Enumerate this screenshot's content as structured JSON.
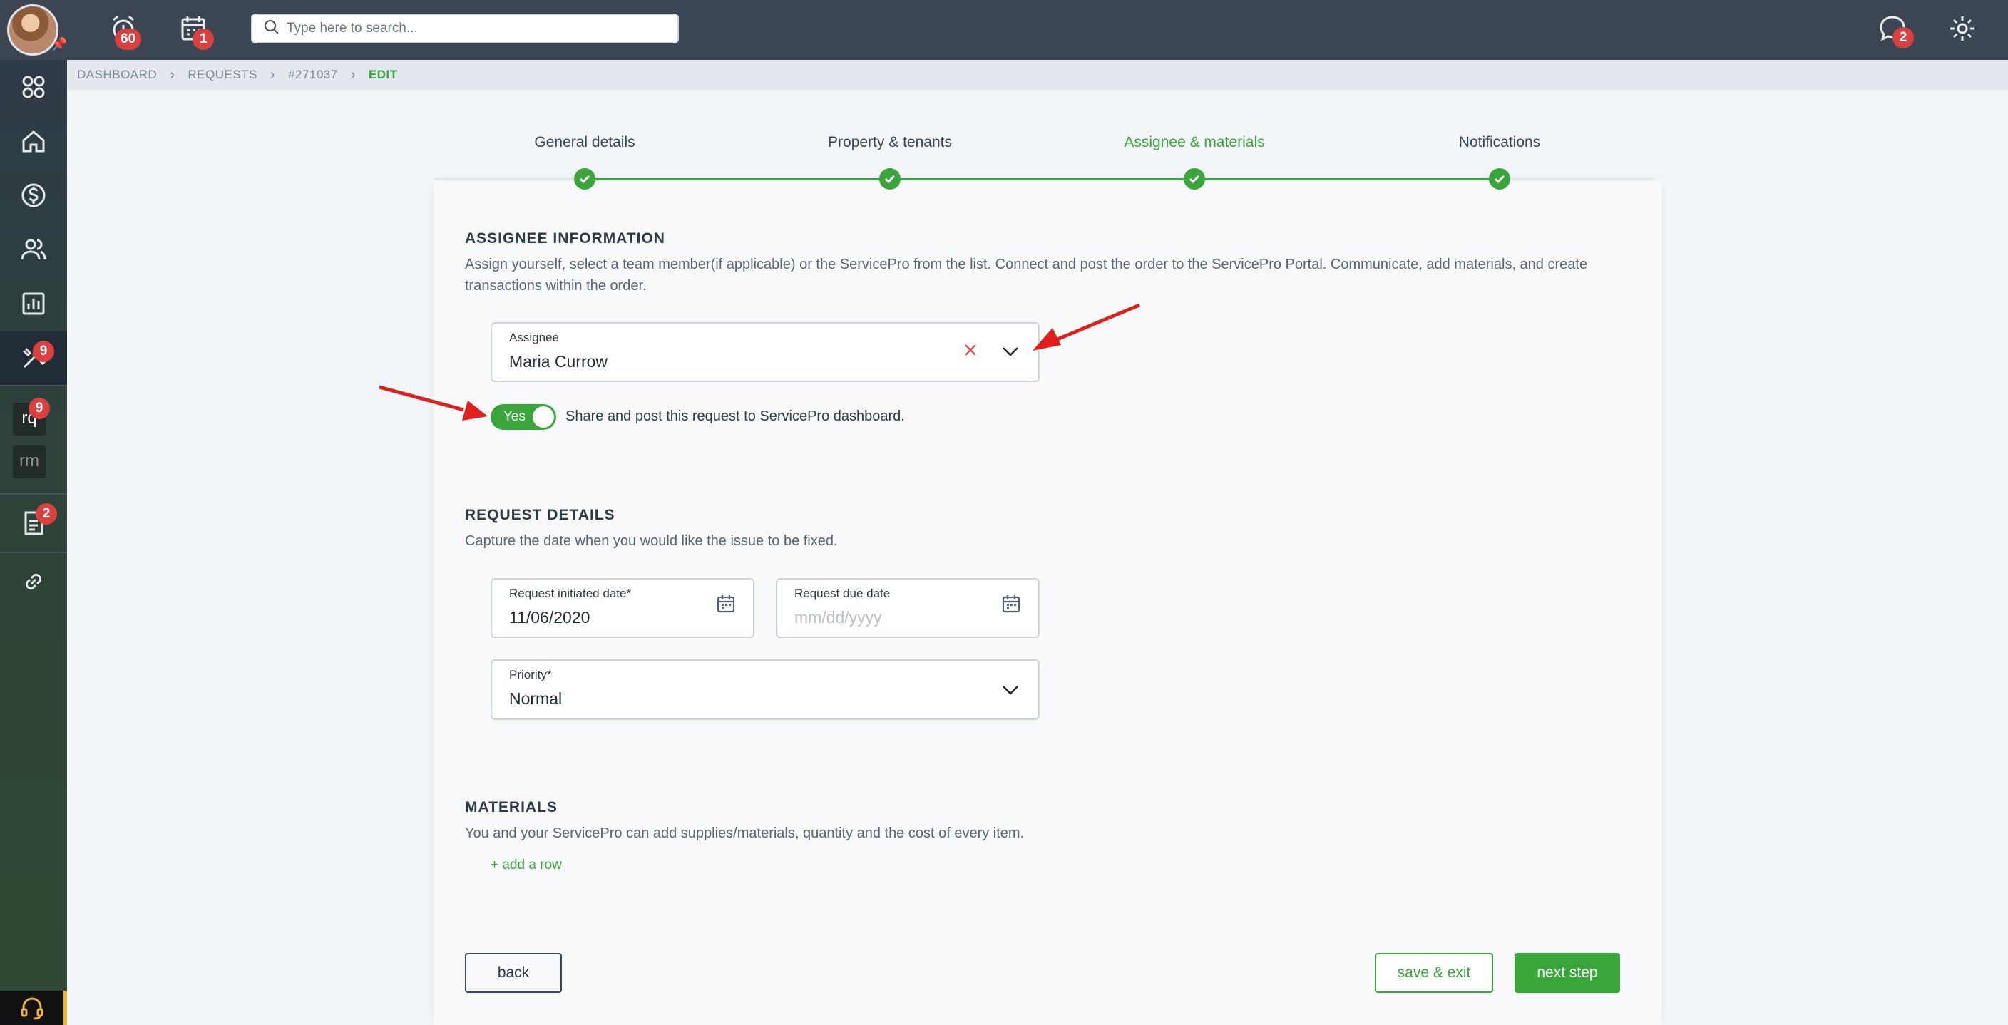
{
  "topbar": {
    "search_placeholder": "Type here to search...",
    "alarm_badge": "60",
    "calendar_badge": "1",
    "chat_badge": "2"
  },
  "sidebar": {
    "maintenance_badge": "9",
    "rq_label": "rq",
    "rq_badge": "9",
    "rm_label": "rm",
    "documents_badge": "2"
  },
  "breadcrumb": [
    "DASHBOARD",
    "REQUESTS",
    "#271037",
    "EDIT"
  ],
  "stepper": {
    "steps": [
      "General details",
      "Property & tenants",
      "Assignee & materials",
      "Notifications"
    ],
    "active_index": 2
  },
  "assignee_section": {
    "title": "ASSIGNEE INFORMATION",
    "description": "Assign yourself, select a team member(if applicable) or the ServicePro from the list. Connect and post the order to the ServicePro Portal. Communicate, add materials, and create transactions within the order.",
    "assignee_label": "Assignee",
    "assignee_value": "Maria Currow",
    "toggle_label": "Yes",
    "toggle_on": true,
    "toggle_description": "Share and post this request to ServicePro dashboard."
  },
  "request_section": {
    "title": "REQUEST DETAILS",
    "description": "Capture the date when you would like the issue to be fixed.",
    "initiated_label": "Request initiated date*",
    "initiated_value": "11/06/2020",
    "due_label": "Request due date",
    "due_placeholder": "mm/dd/yyyy",
    "priority_label": "Priority*",
    "priority_value": "Normal"
  },
  "materials_section": {
    "title": "MATERIALS",
    "description": "You and your ServicePro can add supplies/materials, quantity and the cost of every item.",
    "add_row": "+ add a row"
  },
  "footer": {
    "back": "back",
    "save_exit": "save & exit",
    "next_step": "next step"
  },
  "colors": {
    "accent": "#3aa53a",
    "topbar": "#3c4653",
    "badge": "#d94141",
    "annotation_arrow": "#e0201c"
  }
}
